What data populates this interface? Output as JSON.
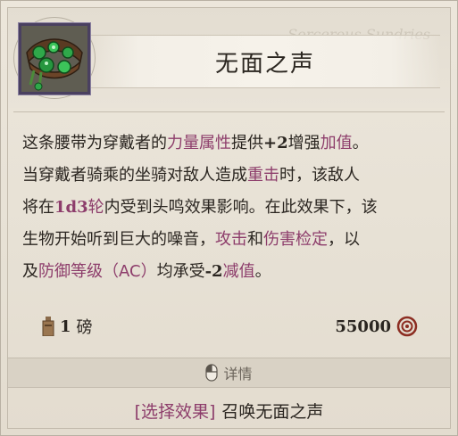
{
  "item": {
    "name": "无面之声",
    "watermark": "Sorcerous Sundries",
    "icon": "belt-icon"
  },
  "description": {
    "line1": [
      {
        "text": "这条腰带为穿戴者的"
      },
      {
        "text": "力量属性",
        "style": "kw"
      },
      {
        "text": "提供"
      },
      {
        "text": "+2",
        "style": "bold"
      },
      {
        "text": "增强"
      },
      {
        "text": "加值",
        "style": "kw"
      },
      {
        "text": "。"
      }
    ],
    "line2": [
      {
        "text": "当穿戴者骑乘的坐骑对敌人造成"
      },
      {
        "text": "重击",
        "style": "kw"
      },
      {
        "text": "时，该敌人"
      }
    ],
    "line3": [
      {
        "text": "将在"
      },
      {
        "text": "1d3",
        "style": "num"
      },
      {
        "text": "轮",
        "style": "kw"
      },
      {
        "text": "内受到头鸣效果影响。在此效果下，该"
      }
    ],
    "line4": [
      {
        "text": "生物开始听到巨大的噪音，"
      },
      {
        "text": "攻击",
        "style": "kw"
      },
      {
        "text": "和"
      },
      {
        "text": "伤害检定",
        "style": "kw"
      },
      {
        "text": "，以"
      }
    ],
    "line5": [
      {
        "text": "及"
      },
      {
        "text": "防御等级（AC）",
        "style": "kw"
      },
      {
        "text": "均承受"
      },
      {
        "text": "-2",
        "style": "bold"
      },
      {
        "text": "减值",
        "style": "kw"
      },
      {
        "text": "。"
      }
    ]
  },
  "weight": {
    "value": "1",
    "unit": "磅",
    "icon": "weight-icon"
  },
  "price": {
    "value": "55000",
    "icon": "coin-icon"
  },
  "details": {
    "label": "详情",
    "icon": "mouse-icon"
  },
  "action": {
    "tag": "[选择效果]",
    "text": "召唤无面之声"
  },
  "colors": {
    "keyword": "#8d3d6b",
    "text": "#2a2520",
    "background": "#ece6db"
  }
}
